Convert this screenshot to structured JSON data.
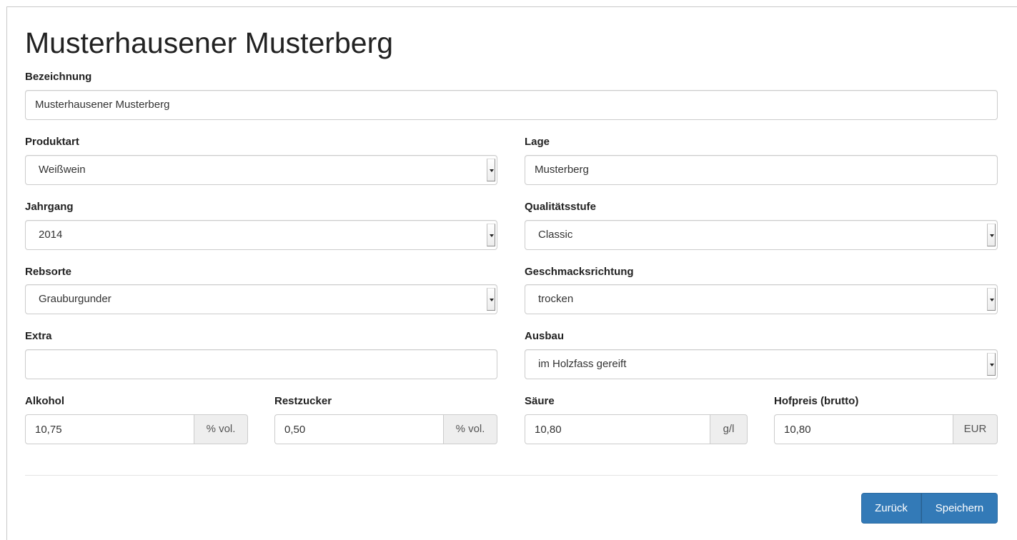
{
  "page": {
    "title": "Musterhausener Musterberg"
  },
  "form": {
    "bezeichnung": {
      "label": "Bezeichnung",
      "value": "Musterhausener Musterberg"
    },
    "produktart": {
      "label": "Produktart",
      "value": "Weißwein"
    },
    "lage": {
      "label": "Lage",
      "value": "Musterberg"
    },
    "jahrgang": {
      "label": "Jahrgang",
      "value": "2014"
    },
    "qualitaetsstufe": {
      "label": "Qualitätsstufe",
      "value": "Classic"
    },
    "rebsorte": {
      "label": "Rebsorte",
      "value": "Grauburgunder"
    },
    "geschmacksrichtung": {
      "label": "Geschmacksrichtung",
      "value": "trocken"
    },
    "extra": {
      "label": "Extra",
      "value": ""
    },
    "ausbau": {
      "label": "Ausbau",
      "value": "im Holzfass gereift"
    },
    "alkohol": {
      "label": "Alkohol",
      "value": "10,75",
      "unit": "% vol."
    },
    "restzucker": {
      "label": "Restzucker",
      "value": "0,50",
      "unit": "% vol."
    },
    "saeure": {
      "label": "Säure",
      "value": "10,80",
      "unit": "g/l"
    },
    "hofpreis": {
      "label": "Hofpreis (brutto)",
      "value": "10,80",
      "unit": "EUR"
    }
  },
  "actions": {
    "back_label": "Zurück",
    "save_label": "Speichern",
    "button_color": "#337ab7"
  }
}
